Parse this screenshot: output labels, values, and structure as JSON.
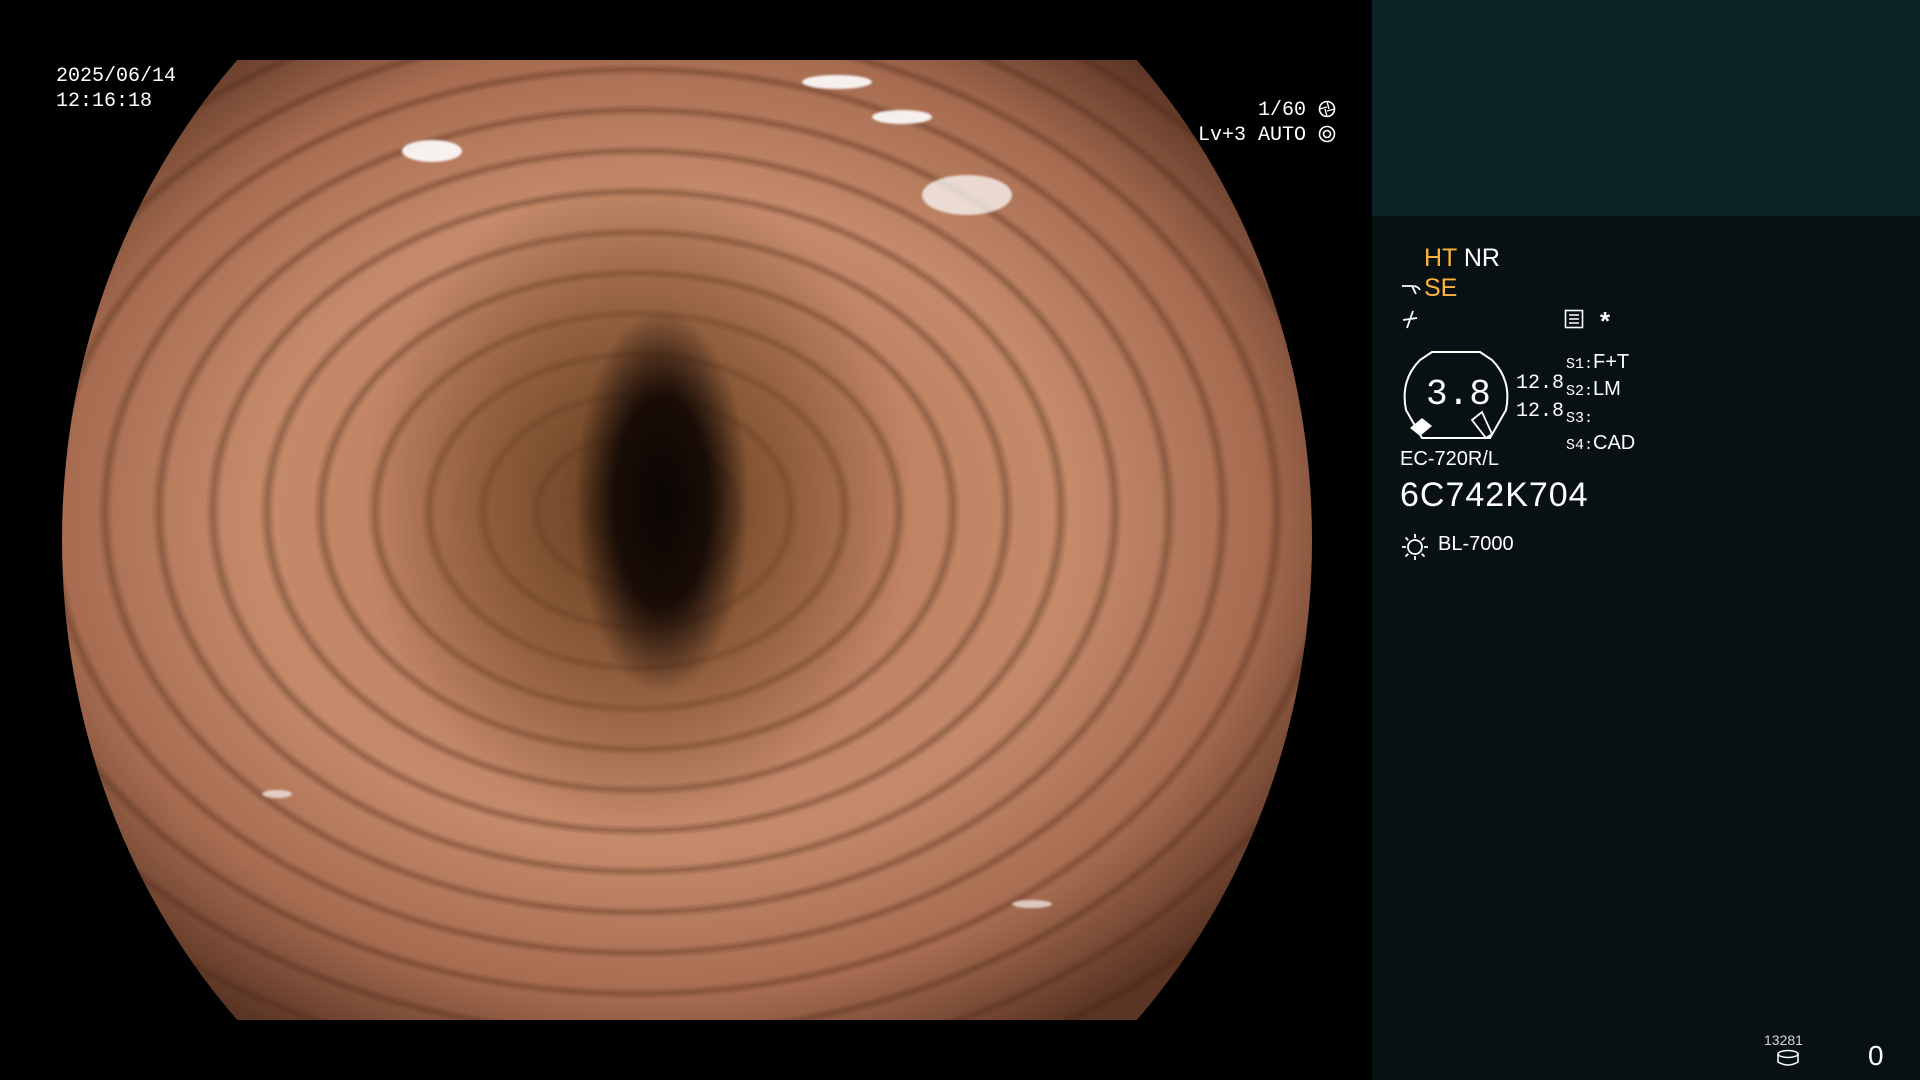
{
  "overlay": {
    "date": "2025/06/14",
    "time": "12:16:18",
    "shutter": "1/60",
    "level": "Lv+3",
    "mode": "AUTO"
  },
  "panel": {
    "ht": "HT",
    "nr": "NR",
    "se": "SE",
    "asterisk": "*",
    "gauge_value": "3.8",
    "gauge_left": "12.8",
    "gauge_right": "12.8",
    "slots": [
      {
        "label": "S1:",
        "value": "F+T"
      },
      {
        "label": "S2:",
        "value": "LM"
      },
      {
        "label": "S3:",
        "value": ""
      },
      {
        "label": "S4:",
        "value": "CAD"
      }
    ],
    "scope_model": "EC-720R/L",
    "serial": "6C742K704",
    "light_source": "BL-7000",
    "storage_count": "13281",
    "counter": "0"
  },
  "colors": {
    "accent": "#ffb33c",
    "panel_bg": "#071113",
    "panel_top_bg": "#0b2325"
  },
  "icons": [
    "shutter-icon",
    "auto-iris-icon",
    "scope-bend-icon",
    "enhance-icon",
    "memory-icon",
    "sun-lamp-icon",
    "disk-icon"
  ]
}
